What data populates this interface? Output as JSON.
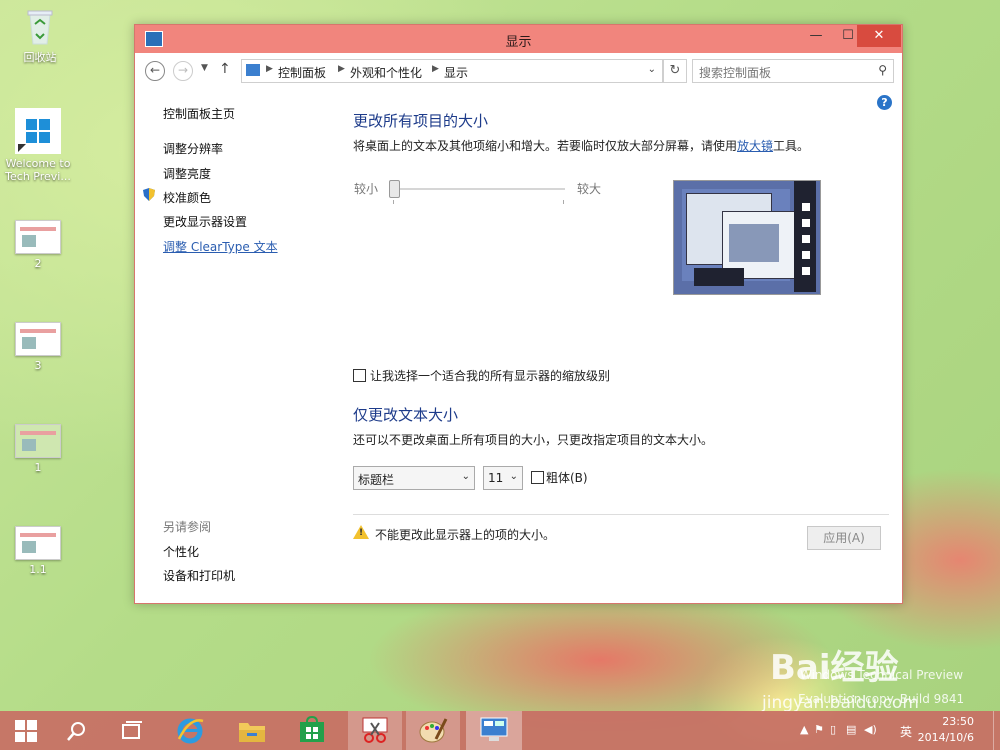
{
  "desktop": {
    "icons": [
      {
        "label": "回收站"
      },
      {
        "label": "Welcome to\nTech Previ..."
      },
      {
        "label": "2"
      },
      {
        "label": "3"
      },
      {
        "label": "1"
      },
      {
        "label": "1.1"
      }
    ]
  },
  "window": {
    "title": "显示",
    "breadcrumb": [
      "控制面板",
      "外观和个性化",
      "显示"
    ],
    "search_placeholder": "搜索控制面板",
    "help": "?"
  },
  "leftnav": {
    "home": "控制面板主页",
    "items": [
      "调整分辨率",
      "调整亮度",
      "校准颜色",
      "更改显示器设置",
      "调整 ClearType 文本"
    ],
    "see_also_heading": "另请参阅",
    "see_also": [
      "个性化",
      "设备和打印机"
    ]
  },
  "main": {
    "section1_title": "更改所有项目的大小",
    "section1_desc_pre": "将桌面上的文本及其他项缩小和增大。若要临时仅放大部分屏幕，请使用",
    "section1_desc_link": "放大镜",
    "section1_desc_post": "工具。",
    "slider_min_label": "较小",
    "slider_max_label": "较大",
    "slider_value": 0,
    "checkbox_label": "让我选择一个适合我的所有显示器的缩放级别",
    "section2_title": "仅更改文本大小",
    "section2_desc": "还可以不更改桌面上所有项目的大小，只更改指定项目的文本大小。",
    "item_select_value": "标题栏",
    "size_select_value": "11",
    "bold_label": "粗体(B)",
    "warning_text": "不能更改此显示器上的项的大小。",
    "apply_label": "应用(A)"
  },
  "taskbar": {
    "time": "23:50",
    "date": "2014/10/6",
    "ime": "英"
  },
  "watermark": {
    "brand": "Bai经验",
    "url": "jingyan.baidu.com",
    "win_text": "Windows Technical Preview",
    "build_text": "Evaluation copy. Build 9841"
  }
}
